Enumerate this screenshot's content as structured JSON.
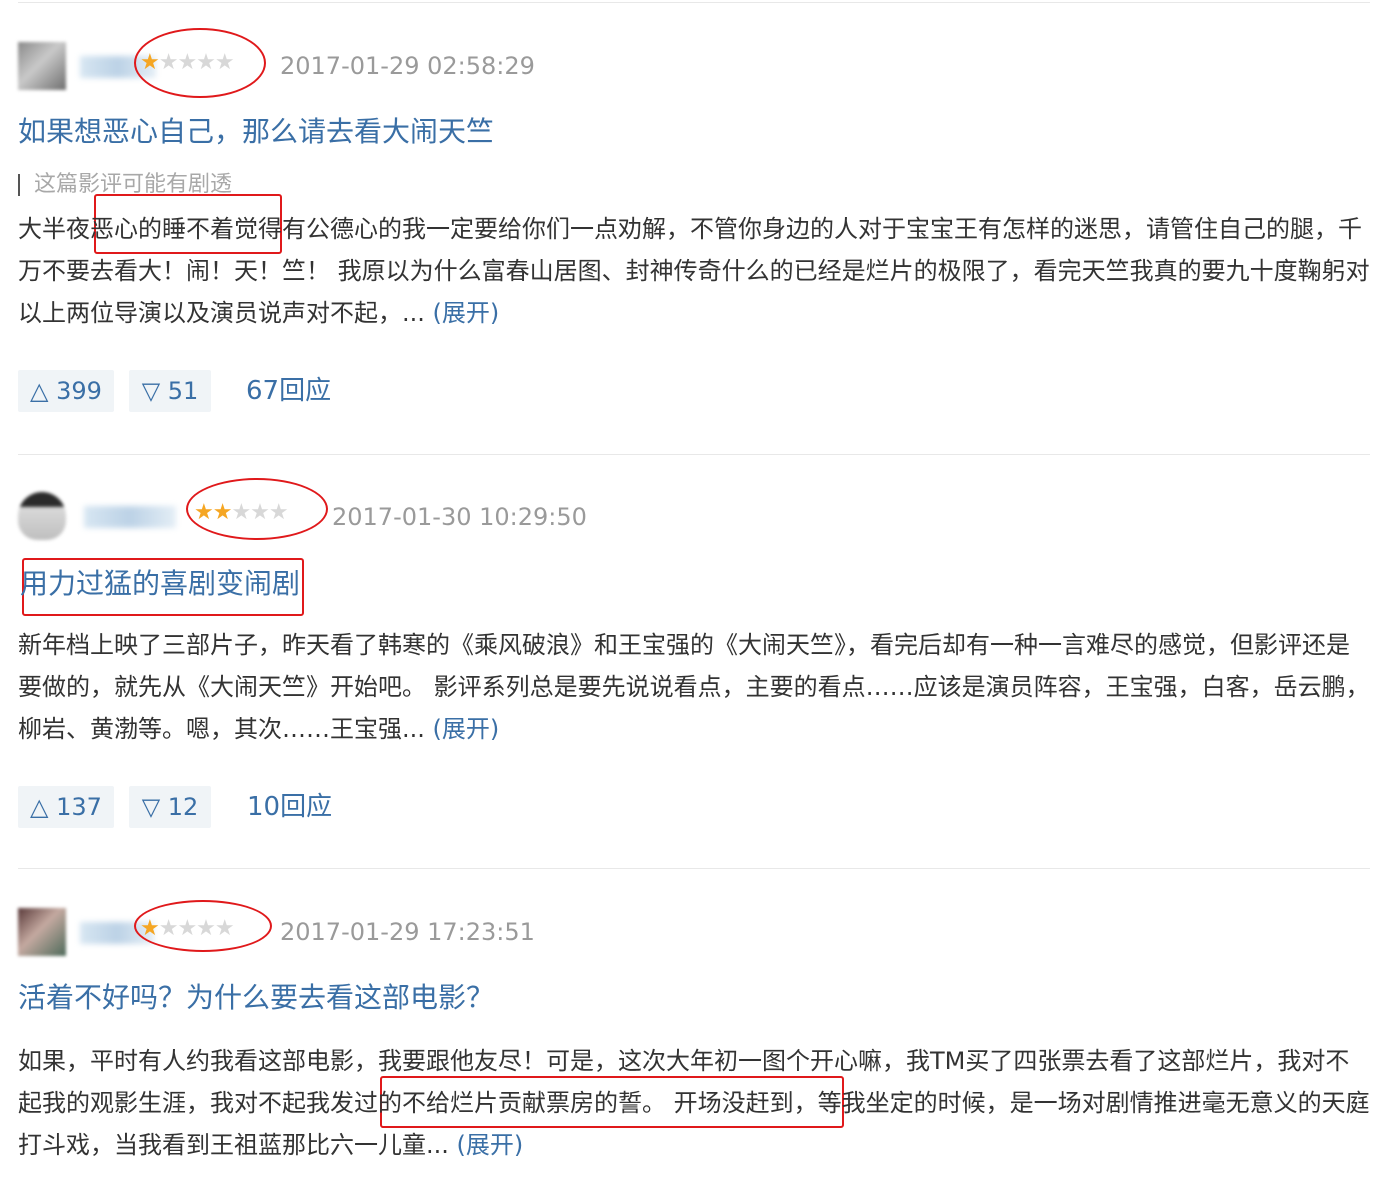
{
  "reviews": [
    {
      "username": "用户",
      "stars_filled": 1,
      "stars_total": 5,
      "time": "2017-01-29 02:58:29",
      "title": "如果想恶心自己，那么请去看大闹天竺",
      "spoiler": "这篇影评可能有剧透",
      "body": "大半夜恶心的睡不着觉得有公德心的我一定要给你们一点劝解，不管你身边的人对于宝宝王有怎样的迷思，请管住自己的腿，千万不要去看大！闹！天！竺！ 我原以为什么富春山居图、封神传奇什么的已经是烂片的极限了，看完天竺我真的要九十度鞠躬对以上两位导演以及演员说声对不起，... ",
      "expand": "(展开)",
      "up": "△ 399",
      "down": "▽ 51",
      "replies": "67回应"
    },
    {
      "username": "木鱼",
      "stars_filled": 2,
      "stars_total": 5,
      "time": "2017-01-30 10:29:50",
      "title": "用力过猛的喜剧变闹剧",
      "body": "新年档上映了三部片子，昨天看了韩寒的《乘风破浪》和王宝强的《大闹天竺》，看完后却有一种一言难尽的感觉，但影评还是要做的，就先从《大闹天竺》开始吧。 影评系列总是要先说说看点，主要的看点……应该是演员阵容，王宝强，白客，岳云鹏，柳岩、黄渤等。嗯，其次……王宝强... ",
      "expand": "(展开)",
      "up": "△ 137",
      "down": "▽ 12",
      "replies": "10回应"
    },
    {
      "username": "豆友",
      "stars_filled": 1,
      "stars_total": 5,
      "time": "2017-01-29 17:23:51",
      "title": "活着不好吗？为什么要去看这部电影？",
      "body": "如果，平时有人约我看这部电影，我要跟他友尽！可是，这次大年初一图个开心嘛，我TM买了四张票去看了这部烂片，我对不起我的观影生涯，我对不起我发过的不给烂片贡献票房的誓。 开场没赶到，等我坐定的时候，是一场对剧情推进毫无意义的天庭打斗戏，当我看到王祖蓝那比六一儿童... ",
      "expand": "(展开)"
    }
  ],
  "colors": {
    "link": "#3a6fa6",
    "star": "#f5a623",
    "annotation": "#e0191b"
  }
}
